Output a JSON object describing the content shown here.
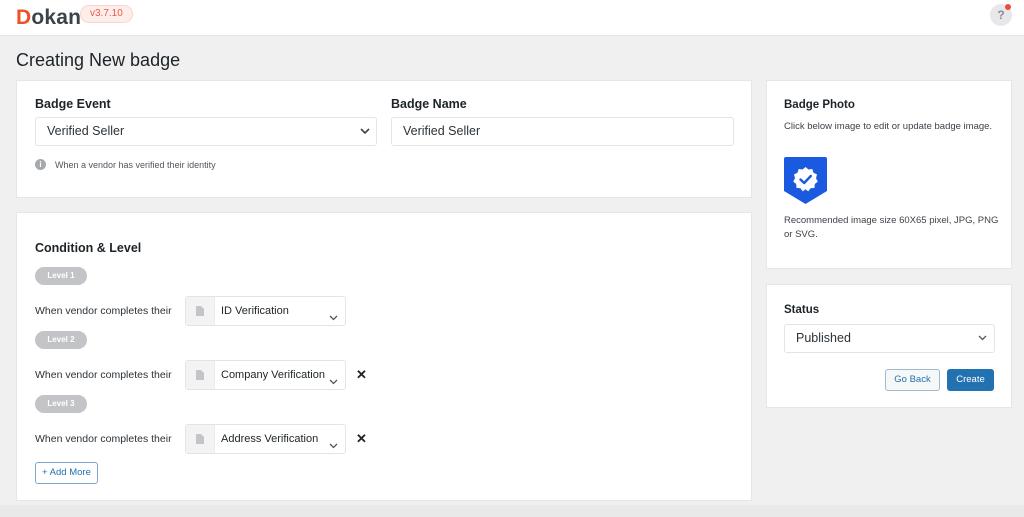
{
  "header": {
    "logo_first": "D",
    "logo_rest": "okan",
    "version": "v3.7.10",
    "help_label": "?"
  },
  "page": {
    "title": "Creating New badge"
  },
  "event_card": {
    "event_label": "Badge Event",
    "event_value": "Verified Seller",
    "hint_icon": "i",
    "hint": "When a vendor has verified their identity",
    "name_label": "Badge Name",
    "name_value": "Verified Seller"
  },
  "condition_card": {
    "title": "Condition & Level",
    "levels": [
      {
        "label": "Level 1",
        "text": "When vendor completes their",
        "value": "ID Verification",
        "removable": false
      },
      {
        "label": "Level 2",
        "text": "When vendor completes their",
        "value": "Company Verification",
        "removable": true
      },
      {
        "label": "Level 3",
        "text": "When vendor completes their",
        "value": "Address Verification",
        "removable": true
      }
    ],
    "remove_label": "✕",
    "add_more": "+ Add More"
  },
  "photo_card": {
    "title": "Badge Photo",
    "description": "Click below image to edit or update badge image.",
    "recommendation": "Recommended image size 60X65 pixel, JPG, PNG or SVG.",
    "badge_color": "#1a5ae0"
  },
  "status_card": {
    "title": "Status",
    "value": "Published",
    "go_back": "Go Back",
    "create": "Create"
  },
  "colors": {
    "brand": "#f05025",
    "primary": "#2271b1"
  }
}
